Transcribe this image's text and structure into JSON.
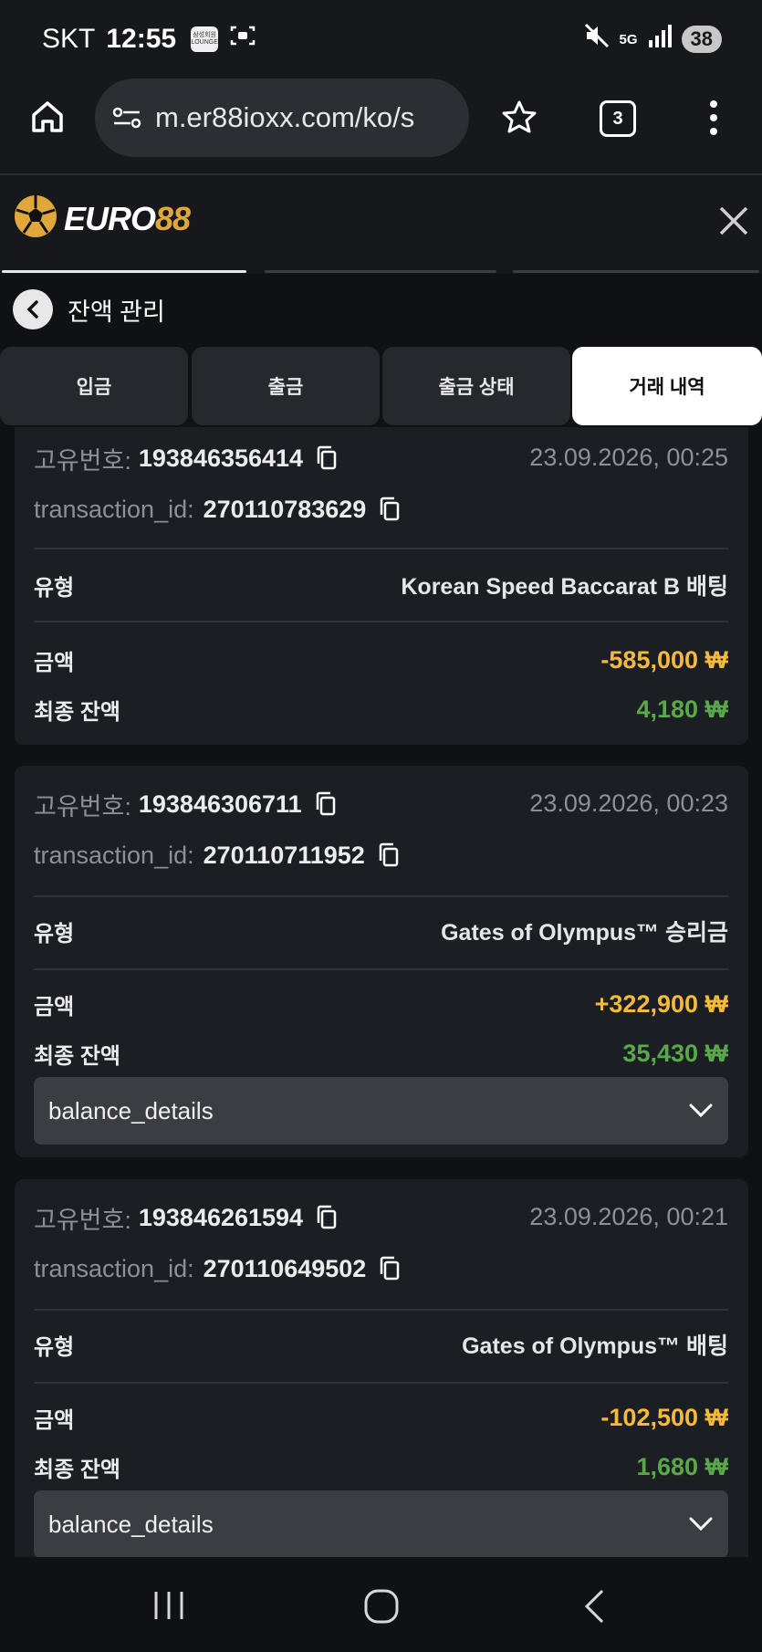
{
  "status_bar": {
    "carrier": "SKT",
    "time": "12:55",
    "mini_badge_line1": "삼성회원",
    "mini_badge_line2": "LOUNGE",
    "network": "5G",
    "battery": "38"
  },
  "browser": {
    "url": "m.er88ioxx.com/ko/s",
    "tab_count": "3"
  },
  "site": {
    "logo_white": "EURO",
    "logo_gold": "88"
  },
  "page": {
    "title": "잔액 관리"
  },
  "tabs": [
    {
      "label": "입금",
      "active": false
    },
    {
      "label": "출금",
      "active": false
    },
    {
      "label": "출금 상태",
      "active": false
    },
    {
      "label": "거래 내역",
      "active": true
    }
  ],
  "labels": {
    "unique_id": "고유번호:",
    "transaction_id": "transaction_id:",
    "type": "유형",
    "amount": "금액",
    "final_balance": "최종 잔액",
    "balance_details": "balance_details"
  },
  "transactions": [
    {
      "unique_id": "193846356414",
      "datetime": "23.09.2026, 00:25",
      "transaction_id": "270110783629",
      "type": "Korean Speed Baccarat B 배팅",
      "amount": "-585,000 ₩",
      "final_balance": "4,180 ₩"
    },
    {
      "unique_id": "193846306711",
      "datetime": "23.09.2026, 00:23",
      "transaction_id": "270110711952",
      "type": "Gates of Olympus™ 승리금",
      "amount": "+322,900 ₩",
      "final_balance": "35,430 ₩"
    },
    {
      "unique_id": "193846261594",
      "datetime": "23.09.2026, 00:21",
      "transaction_id": "270110649502",
      "type": "Gates of Olympus™ 배팅",
      "amount": "-102,500 ₩",
      "final_balance": "1,680 ₩"
    }
  ],
  "colors": {
    "amount": "#f5b93c",
    "balance": "#5aa84a",
    "logo_gold": "#e0a83a"
  }
}
